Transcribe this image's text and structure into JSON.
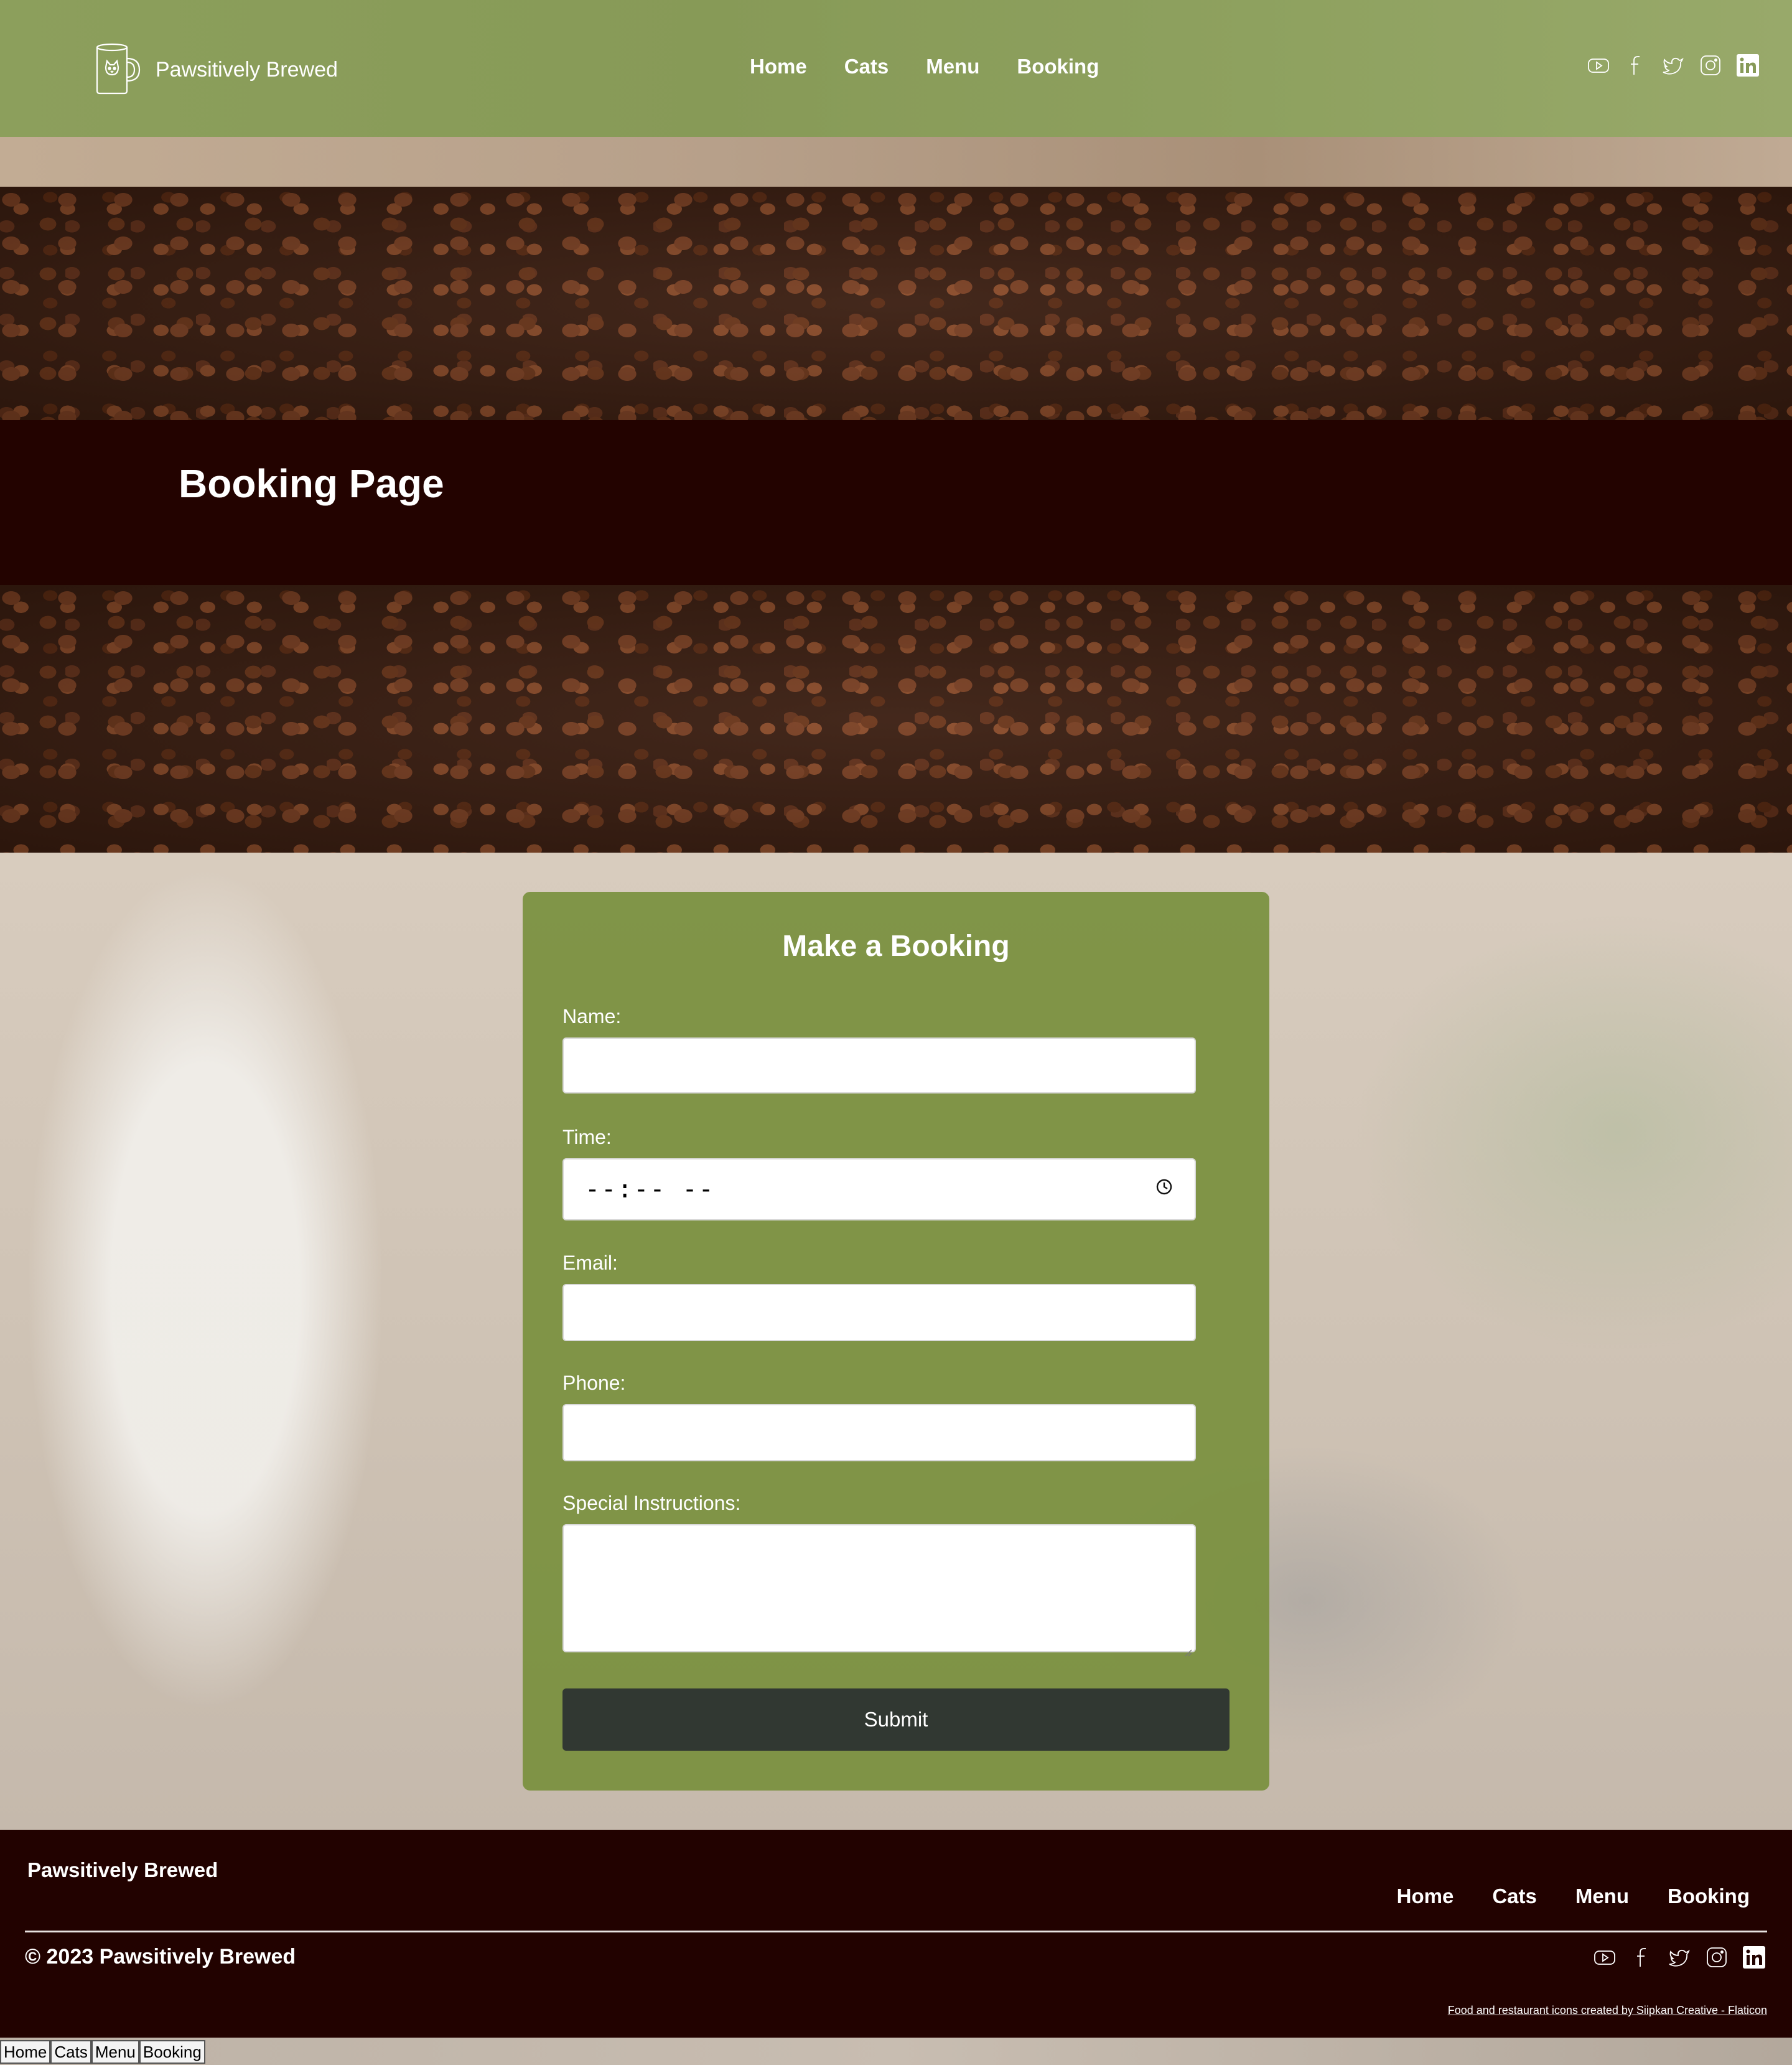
{
  "header": {
    "brand": "Pawsitively Brewed",
    "nav": [
      "Home",
      "Cats",
      "Menu",
      "Booking"
    ]
  },
  "social_icons": [
    "youtube-icon",
    "facebook-icon",
    "twitter-icon",
    "instagram-icon",
    "linkedin-icon"
  ],
  "page_title": "Booking Page",
  "form": {
    "title": "Make a Booking",
    "name_label": "Name:",
    "time_label": "Time:",
    "time_placeholder": "--:-- --",
    "email_label": "Email:",
    "phone_label": "Phone:",
    "instructions_label": "Special Instructions:",
    "submit_label": "Submit"
  },
  "footer": {
    "brand": "Pawsitively Brewed",
    "nav": [
      "Home",
      "Cats",
      "Menu",
      "Booking"
    ],
    "copyright": "© 2023 Pawsitively Brewed",
    "credit": "Food and restaurant icons created by Siipkan Creative - Flaticon"
  },
  "bottom_nav": [
    "Home",
    "Cats",
    "Menu",
    "Booking"
  ],
  "colors": {
    "header_green": "#879a57",
    "dark_maroon": "#230300",
    "card_green": "#7a903e",
    "submit_dark": "#313832"
  }
}
